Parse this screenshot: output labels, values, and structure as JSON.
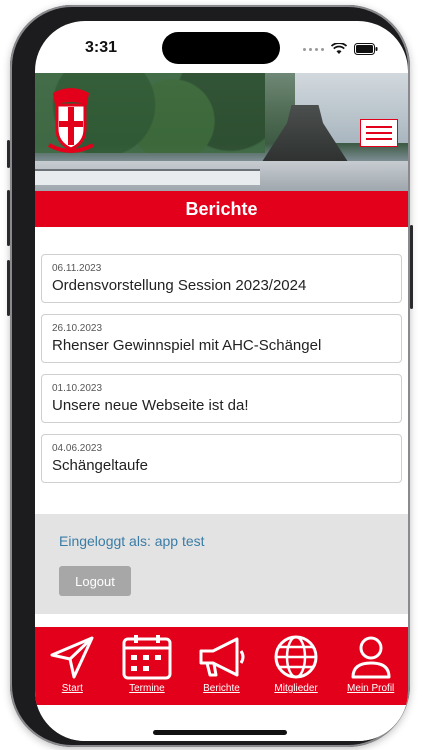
{
  "status_bar": {
    "time": "3:31"
  },
  "header": {
    "menu_label": "Menu"
  },
  "page": {
    "title": "Berichte"
  },
  "reports": [
    {
      "date": "06.11.2023",
      "title": "Ordensvorstellung Session 2023/2024"
    },
    {
      "date": "26.10.2023",
      "title": "Rhenser Gewinnspiel mit AHC-Schängel"
    },
    {
      "date": "01.10.2023",
      "title": "Unsere neue Webseite ist da!"
    },
    {
      "date": "04.06.2023",
      "title": "Schängeltaufe"
    }
  ],
  "login": {
    "text": "Eingeloggt als: app test",
    "logout_label": "Logout"
  },
  "tabbar": {
    "items": [
      {
        "label": "Start",
        "icon": "navigation-arrow-icon"
      },
      {
        "label": "Termine",
        "icon": "calendar-icon"
      },
      {
        "label": "Berichte",
        "icon": "megaphone-icon"
      },
      {
        "label": "Mitglieder",
        "icon": "globe-icon"
      },
      {
        "label": "Mein Profil",
        "icon": "user-icon"
      }
    ]
  },
  "colors": {
    "brand_red": "#e2001a",
    "link_blue": "#3a7ca5",
    "button_gray": "#a7a7a7"
  }
}
